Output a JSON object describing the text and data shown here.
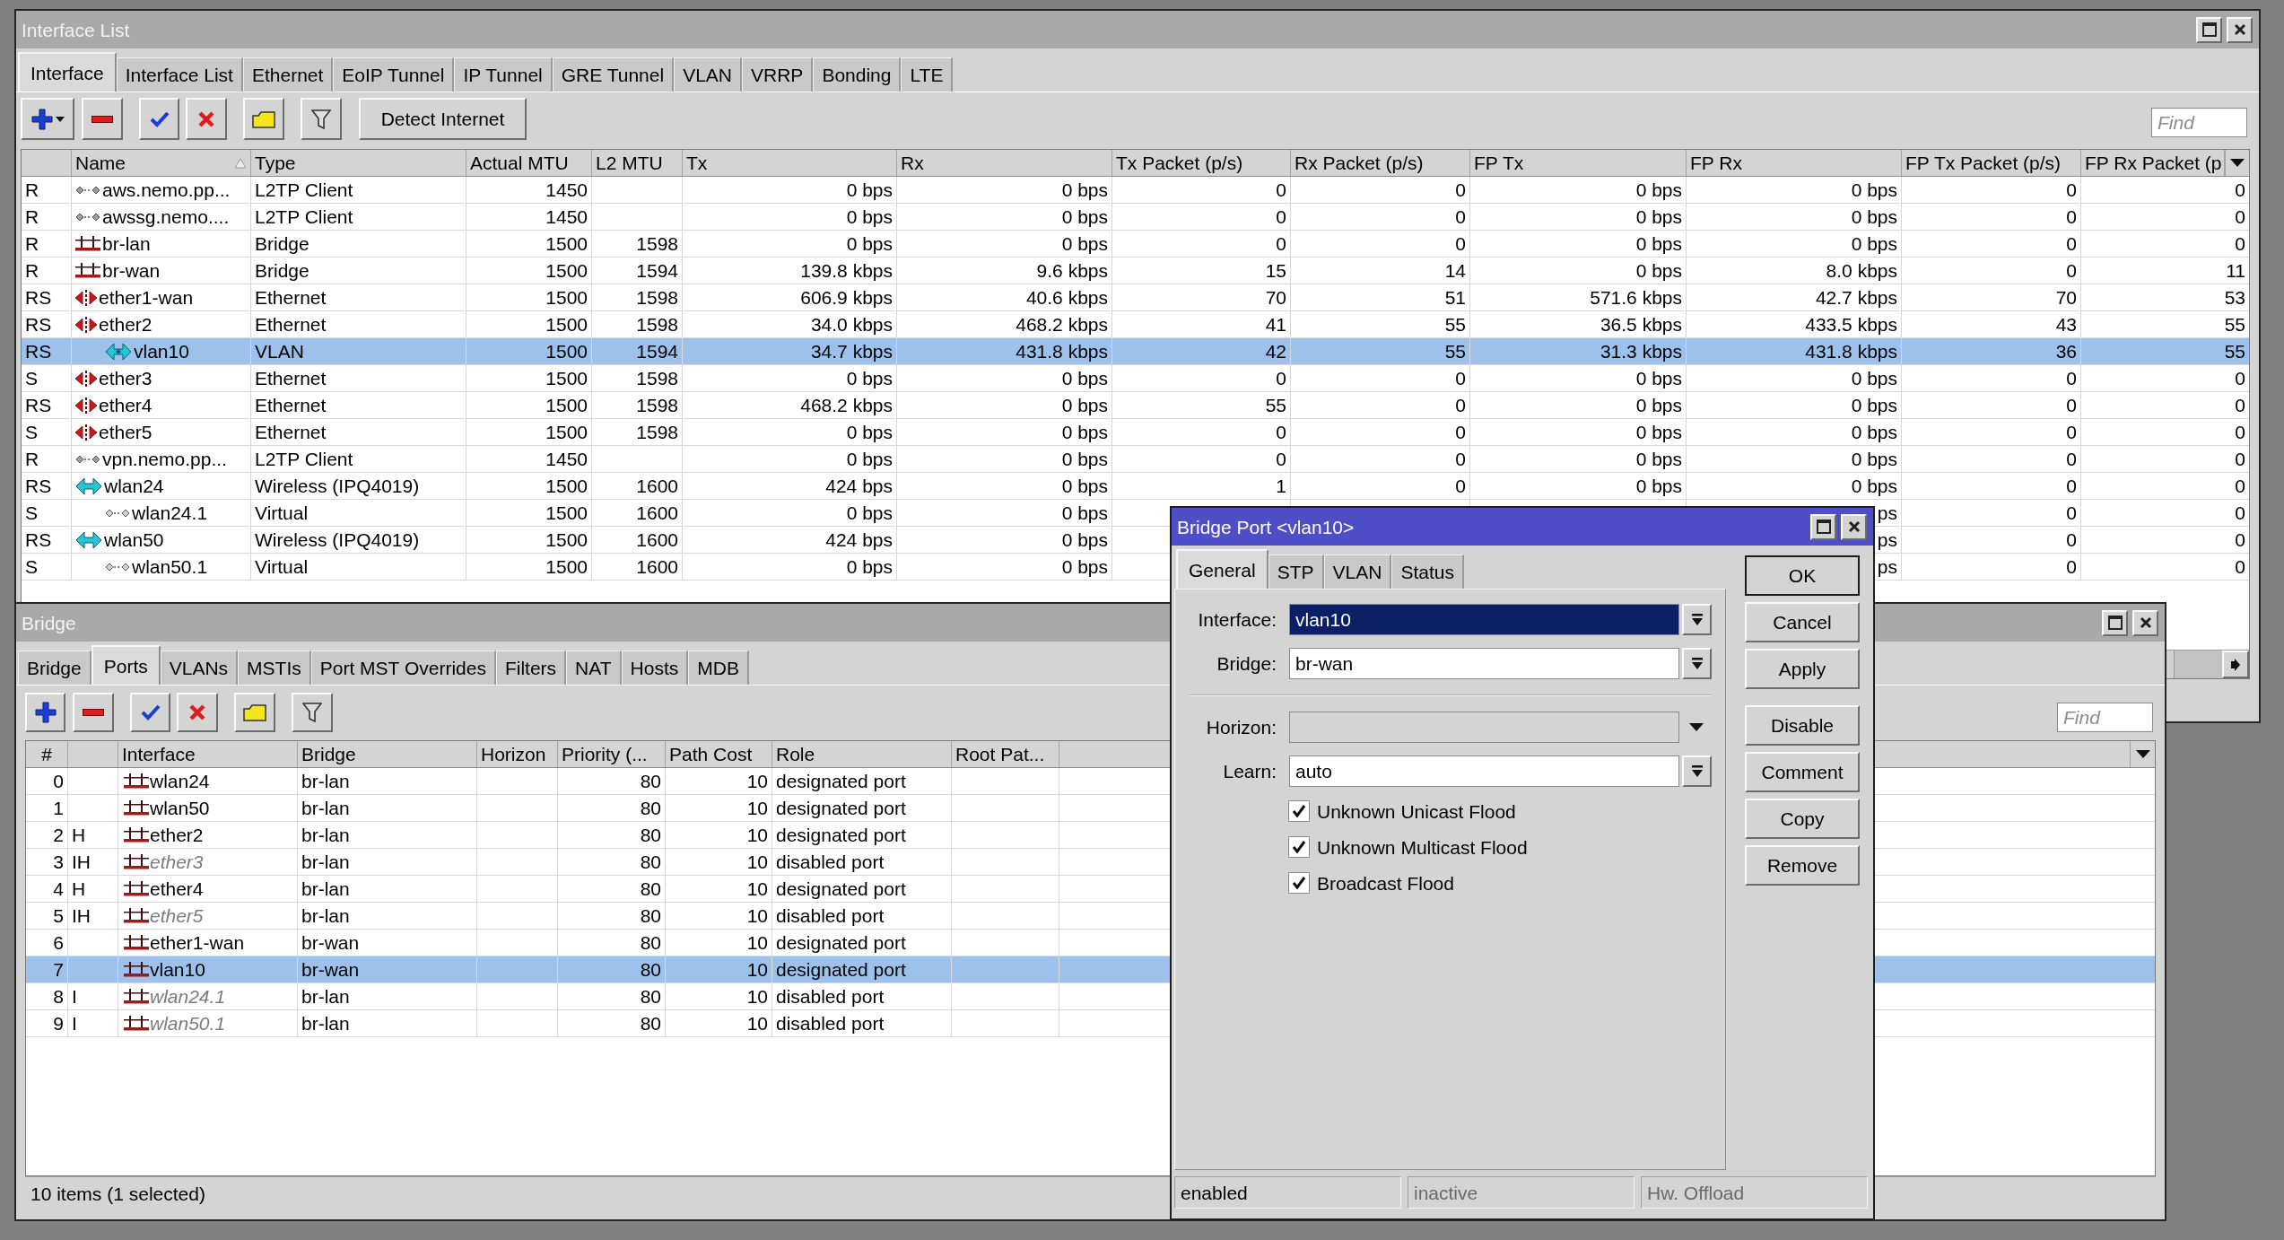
{
  "interface_list_window": {
    "title": "Interface List",
    "focused": false,
    "tabs": [
      {
        "label": "Interface",
        "selected": true
      },
      {
        "label": "Interface List",
        "selected": false
      },
      {
        "label": "Ethernet",
        "selected": false
      },
      {
        "label": "EoIP Tunnel",
        "selected": false
      },
      {
        "label": "IP Tunnel",
        "selected": false
      },
      {
        "label": "GRE Tunnel",
        "selected": false
      },
      {
        "label": "VLAN",
        "selected": false
      },
      {
        "label": "VRRP",
        "selected": false
      },
      {
        "label": "Bonding",
        "selected": false
      },
      {
        "label": "LTE",
        "selected": false
      }
    ],
    "toolbar": {
      "add_has_menu": true,
      "detect_button": "Detect Internet",
      "find": {
        "placeholder": "Find"
      }
    },
    "table": {
      "columns": [
        {
          "label": "Name",
          "sorted": true
        },
        {
          "label": "Type",
          "sorted": false
        },
        {
          "label": "Actual MTU",
          "sorted": false
        },
        {
          "label": "L2 MTU",
          "sorted": false
        },
        {
          "label": "Tx",
          "sorted": false
        },
        {
          "label": "Rx",
          "sorted": false
        },
        {
          "label": "Tx Packet (p/s)",
          "sorted": false
        },
        {
          "label": "Rx Packet (p/s)",
          "sorted": false
        },
        {
          "label": "FP Tx",
          "sorted": false
        },
        {
          "label": "FP Rx",
          "sorted": false
        },
        {
          "label": "FP Tx Packet (p/s)",
          "sorted": false
        },
        {
          "label": "FP Rx Packet (p",
          "sorted": false
        }
      ],
      "rows": [
        {
          "flags": "R",
          "name": "aws.nemo.pp...",
          "kind": "tunnel",
          "type": "L2TP Client",
          "actual_mtu": "1450",
          "tx": "0 bps",
          "rx": "0 bps",
          "tx_packet": "0",
          "rx_packet": "0",
          "fp_tx": "0 bps",
          "fp_rx": "0 bps",
          "fp_tx_packet": "0",
          "fp_rx_packet": "0",
          "selected": false
        },
        {
          "flags": "R",
          "name": "awssg.nemo....",
          "kind": "tunnel",
          "type": "L2TP Client",
          "actual_mtu": "1450",
          "tx": "0 bps",
          "rx": "0 bps",
          "tx_packet": "0",
          "rx_packet": "0",
          "fp_tx": "0 bps",
          "fp_rx": "0 bps",
          "fp_tx_packet": "0",
          "fp_rx_packet": "0",
          "selected": false
        },
        {
          "flags": "R",
          "name": "br-lan",
          "kind": "bridge",
          "type": "Bridge",
          "actual_mtu": "1500",
          "l2_mtu": "1598",
          "tx": "0 bps",
          "rx": "0 bps",
          "tx_packet": "0",
          "rx_packet": "0",
          "fp_tx": "0 bps",
          "fp_rx": "0 bps",
          "fp_tx_packet": "0",
          "fp_rx_packet": "0",
          "selected": false
        },
        {
          "flags": "R",
          "name": "br-wan",
          "kind": "bridge",
          "type": "Bridge",
          "actual_mtu": "1500",
          "l2_mtu": "1594",
          "tx": "139.8 kbps",
          "rx": "9.6 kbps",
          "tx_packet": "15",
          "rx_packet": "14",
          "fp_tx": "0 bps",
          "fp_rx": "8.0 kbps",
          "fp_tx_packet": "0",
          "fp_rx_packet": "11",
          "selected": false
        },
        {
          "flags": "RS",
          "name": "ether1-wan",
          "kind": "ethernet",
          "type": "Ethernet",
          "actual_mtu": "1500",
          "l2_mtu": "1598",
          "tx": "606.9 kbps",
          "rx": "40.6 kbps",
          "tx_packet": "70",
          "rx_packet": "51",
          "fp_tx": "571.6 kbps",
          "fp_rx": "42.7 kbps",
          "fp_tx_packet": "70",
          "fp_rx_packet": "53",
          "selected": false
        },
        {
          "flags": "RS",
          "name": "ether2",
          "kind": "ethernet",
          "type": "Ethernet",
          "actual_mtu": "1500",
          "l2_mtu": "1598",
          "tx": "34.0 kbps",
          "rx": "468.2 kbps",
          "tx_packet": "41",
          "rx_packet": "55",
          "fp_tx": "36.5 kbps",
          "fp_rx": "433.5 kbps",
          "fp_tx_packet": "43",
          "fp_rx_packet": "55",
          "selected": false,
          "children": [
            {
              "flags": "RS",
              "name": "vlan10",
              "kind": "vlan",
              "type": "VLAN",
              "actual_mtu": "1500",
              "l2_mtu": "1594",
              "tx": "34.7 kbps",
              "rx": "431.8 kbps",
              "tx_packet": "42",
              "rx_packet": "55",
              "fp_tx": "31.3 kbps",
              "fp_rx": "431.8 kbps",
              "fp_tx_packet": "36",
              "fp_rx_packet": "55",
              "selected": true
            }
          ]
        },
        {
          "flags": "S",
          "name": "ether3",
          "kind": "ethernet",
          "type": "Ethernet",
          "actual_mtu": "1500",
          "l2_mtu": "1598",
          "tx": "0 bps",
          "rx": "0 bps",
          "tx_packet": "0",
          "rx_packet": "0",
          "fp_tx": "0 bps",
          "fp_rx": "0 bps",
          "fp_tx_packet": "0",
          "fp_rx_packet": "0",
          "selected": false
        },
        {
          "flags": "RS",
          "name": "ether4",
          "kind": "ethernet",
          "type": "Ethernet",
          "actual_mtu": "1500",
          "l2_mtu": "1598",
          "tx": "468.2 kbps",
          "rx": "0 bps",
          "tx_packet": "55",
          "rx_packet": "0",
          "fp_tx": "0 bps",
          "fp_rx": "0 bps",
          "fp_tx_packet": "0",
          "fp_rx_packet": "0",
          "selected": false
        },
        {
          "flags": "S",
          "name": "ether5",
          "kind": "ethernet",
          "type": "Ethernet",
          "actual_mtu": "1500",
          "l2_mtu": "1598",
          "tx": "0 bps",
          "rx": "0 bps",
          "tx_packet": "0",
          "rx_packet": "0",
          "fp_tx": "0 bps",
          "fp_rx": "0 bps",
          "fp_tx_packet": "0",
          "fp_rx_packet": "0",
          "selected": false
        },
        {
          "flags": "R",
          "name": "vpn.nemo.pp...",
          "kind": "tunnel",
          "type": "L2TP Client",
          "actual_mtu": "1450",
          "tx": "0 bps",
          "rx": "0 bps",
          "tx_packet": "0",
          "rx_packet": "0",
          "fp_tx": "0 bps",
          "fp_rx": "0 bps",
          "fp_tx_packet": "0",
          "fp_rx_packet": "0",
          "selected": false
        },
        {
          "flags": "RS",
          "name": "wlan24",
          "kind": "wireless",
          "type": "Wireless (IPQ4019)",
          "actual_mtu": "1500",
          "l2_mtu": "1600",
          "tx": "424 bps",
          "rx": "0 bps",
          "tx_packet": "1",
          "rx_packet": "0",
          "fp_tx": "0 bps",
          "fp_rx": "0 bps",
          "fp_tx_packet": "0",
          "fp_rx_packet": "0",
          "selected": false,
          "children": [
            {
              "flags": "S",
              "name": "wlan24.1",
              "kind": "virtual",
              "type": "Virtual",
              "actual_mtu": "1500",
              "l2_mtu": "1600",
              "tx": "0 bps",
              "rx": "0 bps",
              "fp_rx": "ps",
              "fp_tx_packet": "0",
              "fp_rx_packet": "0",
              "selected": false
            }
          ]
        },
        {
          "flags": "RS",
          "name": "wlan50",
          "kind": "wireless",
          "type": "Wireless (IPQ4019)",
          "actual_mtu": "1500",
          "l2_mtu": "1600",
          "tx": "424 bps",
          "rx": "0 bps",
          "fp_rx": "ps",
          "fp_tx_packet": "0",
          "fp_rx_packet": "0",
          "selected": false,
          "children": [
            {
              "flags": "S",
              "name": "wlan50.1",
              "kind": "virtual",
              "type": "Virtual",
              "actual_mtu": "1500",
              "l2_mtu": "1600",
              "tx": "0 bps",
              "rx": "0 bps",
              "fp_rx": "ps",
              "fp_tx_packet": "0",
              "fp_rx_packet": "0",
              "selected": false
            }
          ]
        }
      ]
    }
  },
  "bridge_window": {
    "title": "Bridge",
    "focused": false,
    "tabs": [
      {
        "label": "Bridge",
        "selected": false
      },
      {
        "label": "Ports",
        "selected": true
      },
      {
        "label": "VLANs",
        "selected": false
      },
      {
        "label": "MSTIs",
        "selected": false
      },
      {
        "label": "Port MST Overrides",
        "selected": false
      },
      {
        "label": "Filters",
        "selected": false
      },
      {
        "label": "NAT",
        "selected": false
      },
      {
        "label": "Hosts",
        "selected": false
      },
      {
        "label": "MDB",
        "selected": false
      }
    ],
    "toolbar": {
      "add_has_menu": false,
      "find": {
        "placeholder": "Find"
      }
    },
    "table": {
      "columns": [
        {
          "label": "#"
        },
        {
          "label": "Interface"
        },
        {
          "label": "Bridge"
        },
        {
          "label": "Horizon"
        },
        {
          "label": "Priority (..."
        },
        {
          "label": "Path Cost"
        },
        {
          "label": "Role"
        },
        {
          "label": "Root Pat..."
        }
      ],
      "rows": [
        {
          "number": "0",
          "interface": "wlan24",
          "bridge": "br-lan",
          "priority": "80",
          "path_cost": "10",
          "role": "designated port",
          "inactive": false,
          "selected": false
        },
        {
          "number": "1",
          "interface": "wlan50",
          "bridge": "br-lan",
          "priority": "80",
          "path_cost": "10",
          "role": "designated port",
          "inactive": false,
          "selected": false
        },
        {
          "number": "2",
          "flags": "H",
          "interface": "ether2",
          "bridge": "br-lan",
          "priority": "80",
          "path_cost": "10",
          "role": "designated port",
          "inactive": false,
          "selected": false
        },
        {
          "number": "3",
          "flags": "IH",
          "interface": "ether3",
          "bridge": "br-lan",
          "priority": "80",
          "path_cost": "10",
          "role": "disabled port",
          "inactive": true,
          "selected": false
        },
        {
          "number": "4",
          "flags": "H",
          "interface": "ether4",
          "bridge": "br-lan",
          "priority": "80",
          "path_cost": "10",
          "role": "designated port",
          "inactive": false,
          "selected": false
        },
        {
          "number": "5",
          "flags": "IH",
          "interface": "ether5",
          "bridge": "br-lan",
          "priority": "80",
          "path_cost": "10",
          "role": "disabled port",
          "inactive": true,
          "selected": false
        },
        {
          "number": "6",
          "interface": "ether1-wan",
          "bridge": "br-wan",
          "priority": "80",
          "path_cost": "10",
          "role": "designated port",
          "inactive": false,
          "selected": false
        },
        {
          "number": "7",
          "interface": "vlan10",
          "bridge": "br-wan",
          "priority": "80",
          "path_cost": "10",
          "role": "designated port",
          "inactive": false,
          "selected": true
        },
        {
          "number": "8",
          "flags": "I",
          "interface": "wlan24.1",
          "bridge": "br-lan",
          "priority": "80",
          "path_cost": "10",
          "role": "disabled port",
          "inactive": true,
          "selected": false
        },
        {
          "number": "9",
          "flags": "I",
          "interface": "wlan50.1",
          "bridge": "br-lan",
          "priority": "80",
          "path_cost": "10",
          "role": "disabled port",
          "inactive": true,
          "selected": false
        }
      ]
    },
    "status_bar": "10 items (1 selected)"
  },
  "bridge_port_dialog": {
    "title": "Bridge Port <vlan10>",
    "focused": true,
    "tabs": [
      {
        "label": "General",
        "selected": true
      },
      {
        "label": "STP",
        "selected": false
      },
      {
        "label": "VLAN",
        "selected": false
      },
      {
        "label": "Status",
        "selected": false
      }
    ],
    "field_groups": [
      [
        {
          "label": "Interface:",
          "value": "vlan10",
          "kind": "combo",
          "text_selected": true
        },
        {
          "label": "Bridge:",
          "value": "br-wan",
          "kind": "combo",
          "text_selected": false
        }
      ],
      [
        {
          "label": "Horizon:",
          "kind": "unset",
          "text_selected": false
        },
        {
          "label": "Learn:",
          "value": "auto",
          "kind": "combo",
          "text_selected": false
        }
      ]
    ],
    "checkboxes": [
      {
        "label": "Unknown Unicast Flood",
        "checked": true
      },
      {
        "label": "Unknown Multicast Flood",
        "checked": true
      },
      {
        "label": "Broadcast Flood",
        "checked": true
      }
    ],
    "button_groups": [
      [
        {
          "label": "OK",
          "default": true
        },
        {
          "label": "Cancel",
          "default": false
        },
        {
          "label": "Apply",
          "default": false
        }
      ],
      [
        {
          "label": "Disable",
          "default": false
        },
        {
          "label": "Comment",
          "default": false
        },
        {
          "label": "Copy",
          "default": false
        },
        {
          "label": "Remove",
          "default": false
        }
      ]
    ],
    "status_bar": [
      {
        "text": "enabled",
        "active": true
      },
      {
        "text": "inactive",
        "active": false
      },
      {
        "text": "Hw. Offload",
        "active": false
      }
    ]
  }
}
